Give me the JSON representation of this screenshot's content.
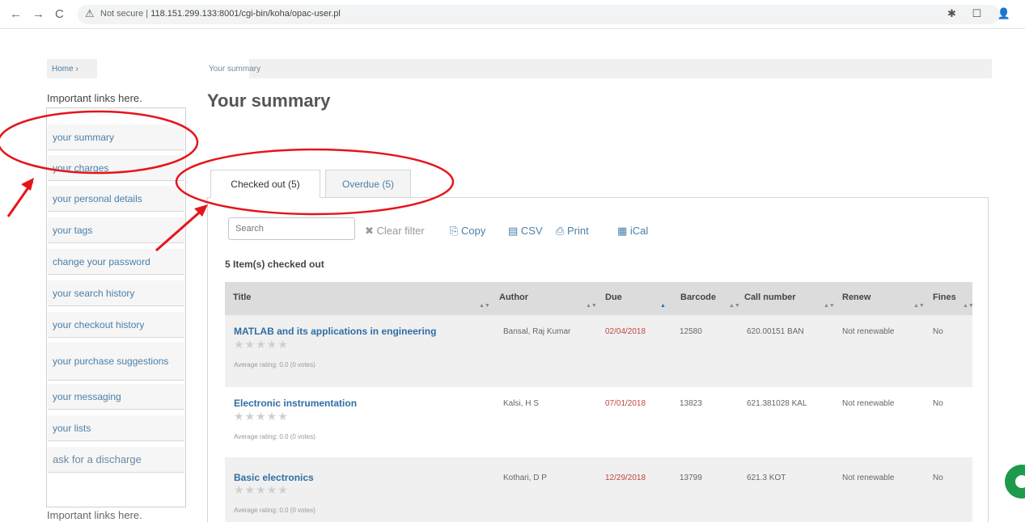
{
  "browser": {
    "back_icon": "←",
    "forward_icon": "→",
    "reload_icon": "C",
    "security_label": "Not secure",
    "url": "118.151.299.133:8001/cgi-bin/koha/opac-user.pl",
    "omni_icons": "🔑 🔍 ⇪ ☆",
    "extension_icons": "✱ ☐ 👤"
  },
  "breadcrumb": {
    "home": "Home ›",
    "current": "Your summary"
  },
  "sidebar": {
    "title": "Important links here.",
    "items": [
      {
        "label": "your summary"
      },
      {
        "label": "your charges"
      },
      {
        "label": "your personal details"
      },
      {
        "label": "your tags"
      },
      {
        "label": "change your password"
      },
      {
        "label": "your search history"
      },
      {
        "label": "your checkout history"
      },
      {
        "label": "your purchase suggestions"
      },
      {
        "label": "your messaging"
      },
      {
        "label": "your lists"
      },
      {
        "label": "ask for a discharge"
      }
    ],
    "bottom_text": "Important links here."
  },
  "main": {
    "title": "Your summary",
    "tabs": [
      {
        "label": "Checked out (5)"
      },
      {
        "label": "Overdue (5)"
      }
    ],
    "search_placeholder": "Search",
    "toolbar": {
      "clear_filter": "✖ Clear filter",
      "copy": "⎘ Copy",
      "csv": "▤ CSV",
      "print": "⎙ Print",
      "ical": "▦ iCal"
    },
    "count_text": "5 Item(s) checked out",
    "columns": [
      "Title",
      "Author",
      "Due",
      "Barcode",
      "Call number",
      "Renew",
      "Fines"
    ],
    "rows": [
      {
        "title": "MATLAB and its applications in engineering",
        "stars": "★★★★★",
        "rating": "Average rating: 0.0 (0 votes)",
        "author": "Bansal, Raj Kumar",
        "due": "02/04/2018",
        "barcode": "12580",
        "call_number": "620.00151 BAN",
        "renew": "Not renewable",
        "fines": "No"
      },
      {
        "title": "Electronic instrumentation",
        "stars": "★★★★★",
        "rating": "Average rating: 0.0 (0 votes)",
        "author": "Kalsi, H S",
        "due": "07/01/2018",
        "barcode": "13823",
        "call_number": "621.381028 KAL",
        "renew": "Not renewable",
        "fines": "No"
      },
      {
        "title": "Basic electronics",
        "stars": "★★★★★",
        "rating": "Average rating: 0.0 (0 votes)",
        "author": "Kothari, D P",
        "due": "12/29/2018",
        "barcode": "13799",
        "call_number": "621.3 KOT",
        "renew": "Not renewable",
        "fines": "No"
      }
    ]
  },
  "colors": {
    "link": "#4a7fa9",
    "annotation": "#e5141b",
    "overdue": "#c14646",
    "chat": "#1d9a4b"
  }
}
